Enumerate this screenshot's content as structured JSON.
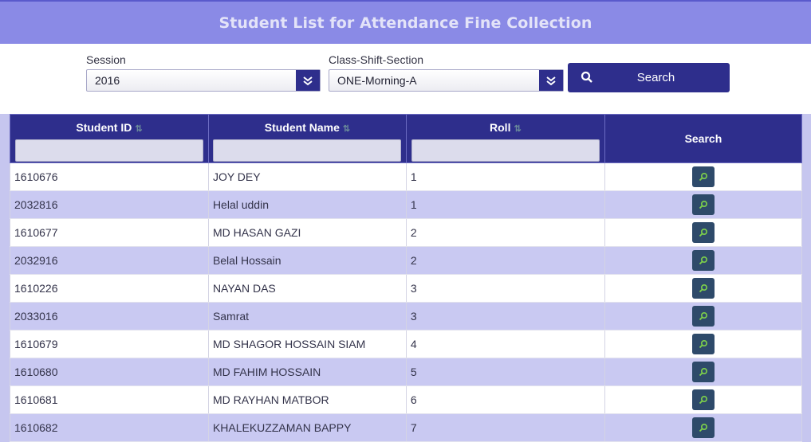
{
  "page": {
    "title": "Student List for Attendance Fine Collection"
  },
  "filters": {
    "session_label": "Session",
    "session_value": "2016",
    "class_label": "Class-Shift-Section",
    "class_value": "ONE-Morning-A",
    "search_button_label": "Search",
    "search_icon": "search-icon",
    "dropdown_icon": "chevron-down-icon"
  },
  "table": {
    "headers": {
      "student_id": "Student ID",
      "student_name": "Student Name",
      "roll": "Roll",
      "search": "Search"
    },
    "sort_icon": "sort-icon",
    "row_action_icon": "search-icon",
    "rows": [
      {
        "id": "1610676",
        "name": "JOY DEY",
        "roll": "1"
      },
      {
        "id": "2032816",
        "name": "Helal uddin",
        "roll": "1"
      },
      {
        "id": "1610677",
        "name": "MD HASAN GAZI",
        "roll": "2"
      },
      {
        "id": "2032916",
        "name": "Belal Hossain",
        "roll": "2"
      },
      {
        "id": "1610226",
        "name": "NAYAN DAS",
        "roll": "3"
      },
      {
        "id": "2033016",
        "name": "Samrat",
        "roll": "3"
      },
      {
        "id": "1610679",
        "name": "MD SHAGOR HOSSAIN SIAM",
        "roll": "4"
      },
      {
        "id": "1610680",
        "name": "MD FAHIM HOSSAIN",
        "roll": "5"
      },
      {
        "id": "1610681",
        "name": "MD RAYHAN MATBOR",
        "roll": "6"
      },
      {
        "id": "1610682",
        "name": "KHALEKUZZAMAN BAPPY",
        "roll": "7"
      }
    ]
  },
  "colors": {
    "title_bar": "#8a8ae6",
    "primary": "#2e2e8c",
    "row_alt": "#c9c9f2",
    "row_button": "#2e4a6a"
  }
}
